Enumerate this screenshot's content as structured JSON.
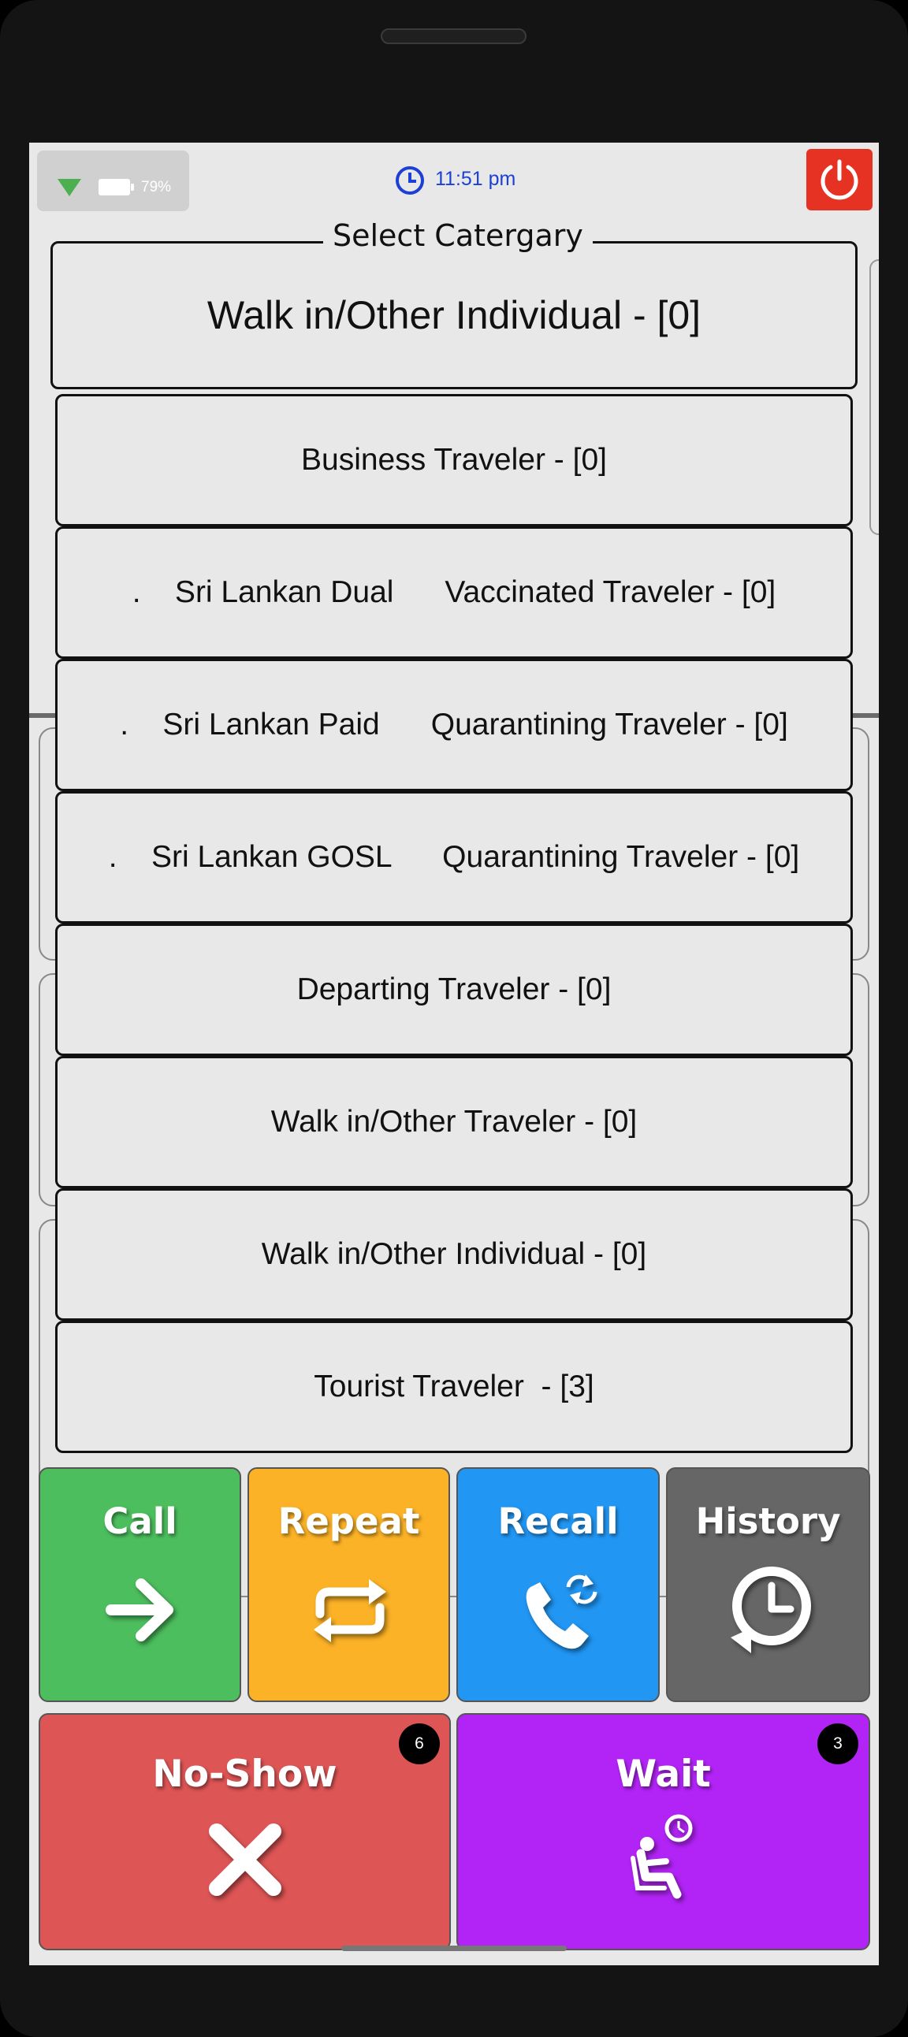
{
  "status_bar": {
    "battery_percent": "79%",
    "time": "11:51 pm",
    "icons": [
      "wifi-icon",
      "battery-icon",
      "clock-icon",
      "power-icon"
    ],
    "power_button_color": "#e53222"
  },
  "category_select": {
    "legend": "Select Catergary",
    "selected_value": "Walk in/Other Individual - [0]",
    "options": [
      "Business Traveler - [0]",
      ".    Sri Lankan Dual      Vaccinated Traveler - [0]",
      ".    Sri Lankan Paid      Quarantining Traveler - [0]",
      ".    Sri Lankan GOSL      Quarantining Traveler - [0]",
      "Departing Traveler - [0]",
      "Walk in/Other Traveler - [0]",
      "Walk in/Other Individual - [0]",
      "Tourist Traveler  - [3]"
    ]
  },
  "actions": {
    "call": {
      "label": "Call",
      "color": "#4cbe5e",
      "icon": "arrow-right-icon"
    },
    "repeat": {
      "label": "Repeat",
      "color": "#fbb226",
      "icon": "repeat-icon"
    },
    "recall": {
      "label": "Recall",
      "color": "#2196f3",
      "icon": "phone-refresh-icon"
    },
    "history": {
      "label": "History",
      "color": "#666666",
      "icon": "history-clock-icon"
    },
    "no_show": {
      "label": "No-Show",
      "color": "#de5555",
      "icon": "close-icon",
      "badge": "6"
    },
    "wait": {
      "label": "Wait",
      "color": "#b224f6",
      "icon": "seated-wait-icon",
      "badge": "3"
    }
  }
}
